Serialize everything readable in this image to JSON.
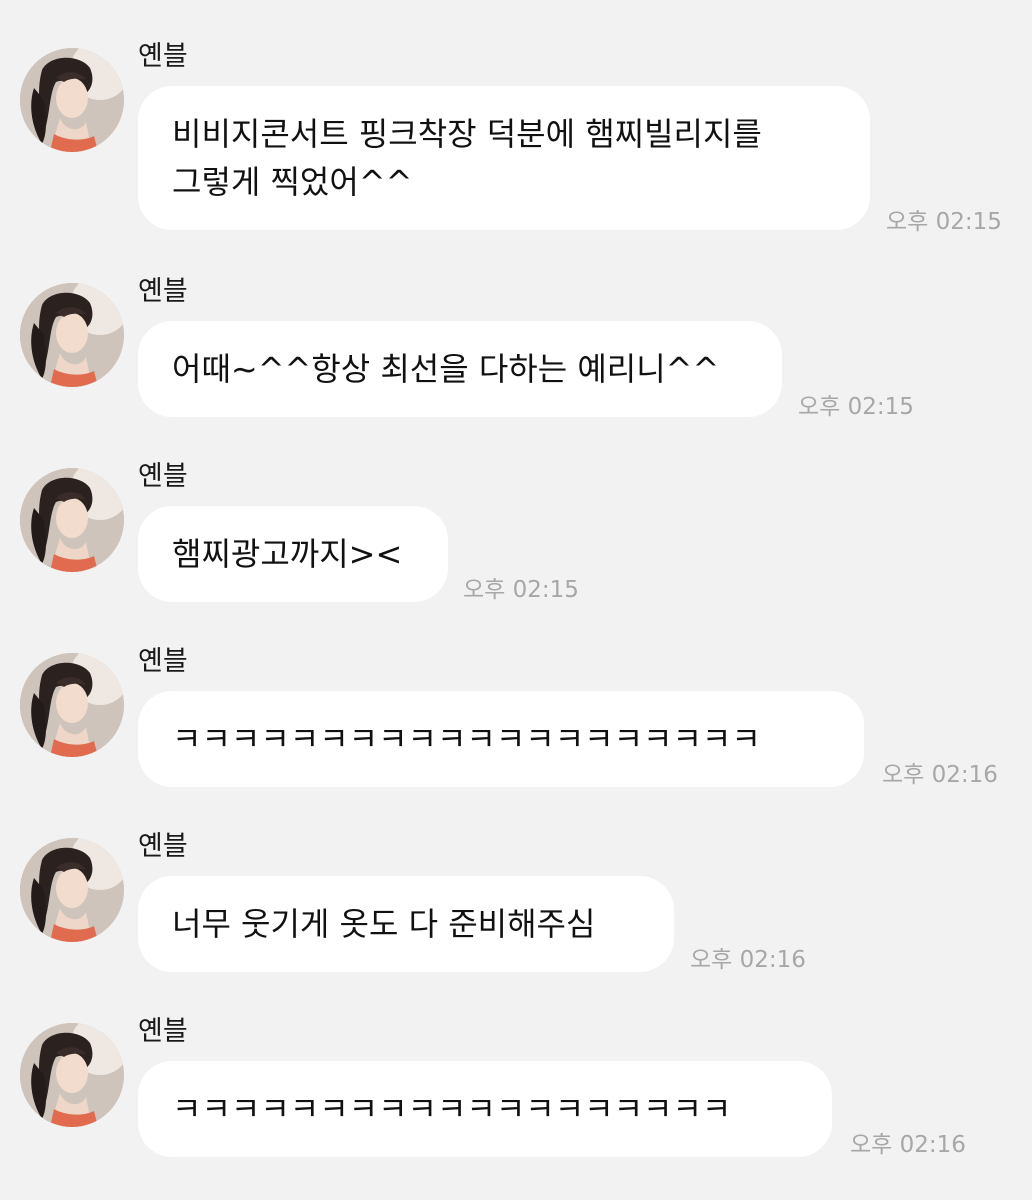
{
  "messages": [
    {
      "sender": "옌블",
      "text": "비비지콘서트 핑크착장 덕분에 햄찌빌리지를\n그렇게 찍었어^^",
      "time": "오후 02:15"
    },
    {
      "sender": "옌블",
      "text": "어때~^^항상 최선을 다하는 예리니^^",
      "time": "오후 02:15"
    },
    {
      "sender": "옌블",
      "text": "햄찌광고까지><",
      "time": "오후 02:15"
    },
    {
      "sender": "옌블",
      "text": "ㅋㅋㅋㅋㅋㅋㅋㅋㅋㅋㅋㅋㅋㅋㅋㅋㅋㅋㅋㅋ",
      "time": "오후 02:16"
    },
    {
      "sender": "옌블",
      "text": "너무 웃기게 옷도 다 준비해주심",
      "time": "오후 02:16"
    },
    {
      "sender": "옌블",
      "text": "ㅋㅋㅋㅋㅋㅋㅋㅋㅋㅋㅋㅋㅋㅋㅋㅋㅋㅋㅋ",
      "time": "오후 02:16"
    }
  ]
}
